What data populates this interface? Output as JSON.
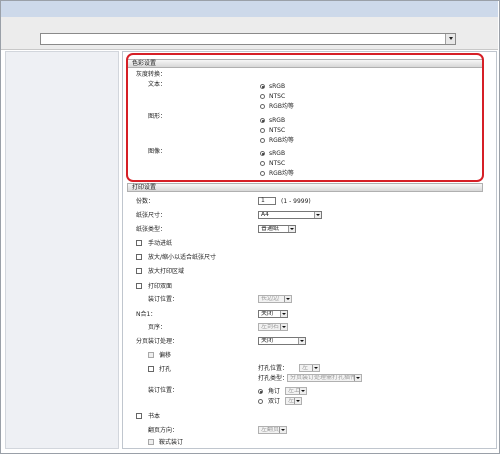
{
  "address": {
    "value": ""
  },
  "color_settings": {
    "header": "色彩设置",
    "gray_conversion": "灰度转换：",
    "text_label": "文本：",
    "graphics_label": "图形：",
    "image_label": "图像：",
    "options": [
      "sRGB",
      "NTSC",
      "RGB均等"
    ],
    "selected": "sRGB"
  },
  "print_settings": {
    "header": "打印设置",
    "copies_label": "份数：",
    "copies_value": "1",
    "copies_range": "(1 - 9999)",
    "paper_size_label": "纸张尺寸：",
    "paper_size_value": "A4",
    "paper_type_label": "纸张类型：",
    "paper_type_value": "普通纸",
    "manual_feed": "手动进纸",
    "fit_paper": "放大/缩小以适合纸张尺寸",
    "enlarge_area": "放大打印区域",
    "duplex": "打印双面",
    "binding_position_label": "装订位置：",
    "binding_position_value": "长边边",
    "n_up_label": "N合1：",
    "n_up_value": "关闭",
    "page_order_label": "页序：",
    "page_order_value": "左到右",
    "finishing_label": "分页装订处理：",
    "finishing_value": "关闭",
    "offset": "偏移",
    "punch": "打孔",
    "punch_position_label": "打孔位置：",
    "punch_position_value": "左",
    "punch_type_label": "打孔类型：",
    "punch_type_value": "分页装订处理需打孔插件",
    "binding_label": "装订位置：",
    "corner_option": "角订",
    "corner_value": "左上",
    "double_option": "双订",
    "double_value": "左",
    "booklet": "书本",
    "page_direction_label": "翻页方向：",
    "page_direction_value": "左翻页",
    "saddle_stitch": "鞍式装订"
  }
}
